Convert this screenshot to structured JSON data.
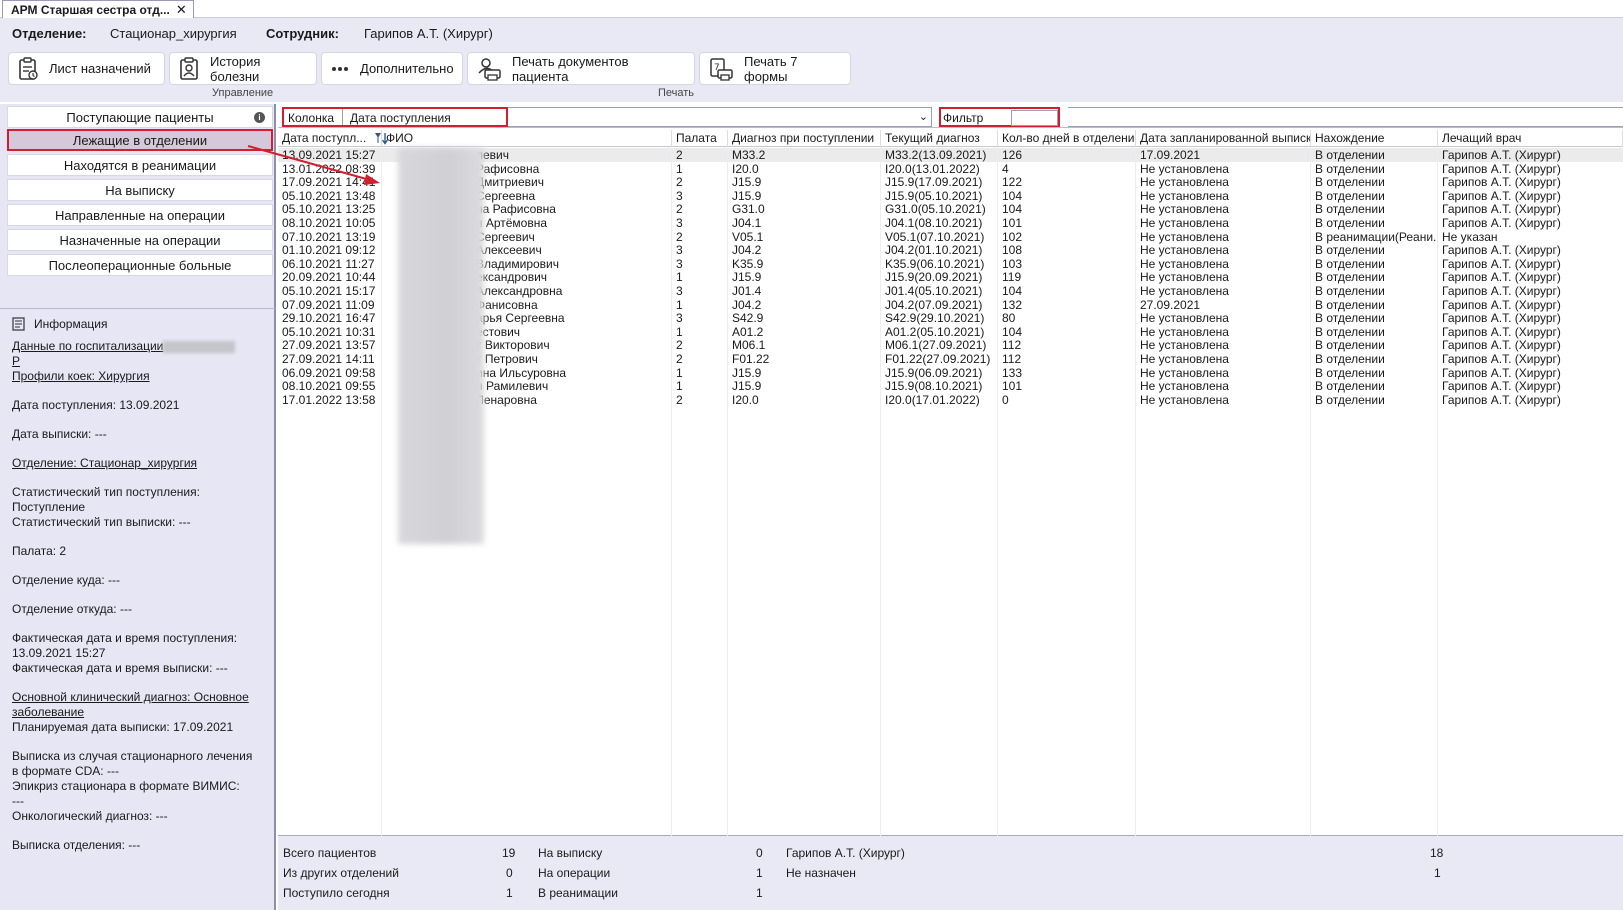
{
  "tab": {
    "title": "АРМ Старшая сестра отд...",
    "close": "✕"
  },
  "header": {
    "dept_label": "Отделение:",
    "dept_value": "Стационар_хирургия",
    "emp_label": "Сотрудник:",
    "emp_value": "Гарипов А.Т. (Хирург)"
  },
  "toolbar": {
    "list_label": "Лист назначений",
    "history_label": "История болезни",
    "more_label": "Дополнительно",
    "print_docs_label": "Печать документов пациента",
    "print7_label": "Печать 7 формы",
    "group_manage": "Управление",
    "group_print": "Печать"
  },
  "nav": {
    "items": [
      "Поступающие пациенты",
      "Лежащие в отделении",
      "Находятся в реанимации",
      "На выписку",
      "Направленные на операции",
      "Назначенные на операции",
      "Послеоперационные больные"
    ]
  },
  "info": {
    "title": "Информация",
    "hospitalization": "Данные по госпитализации",
    "p_letter": "Р",
    "bed_profile": "Профили коек: Хирургия",
    "admit_date": "Дата поступления: 13.09.2021",
    "discharge_date": "Дата выписки: ---",
    "department": "Отделение: Стационар_хирургия",
    "stat_admit_1": "Статистический тип поступления:",
    "stat_admit_2": "Поступление",
    "stat_discharge": "Статистический тип выписки: ---",
    "ward": "Палата: 2",
    "dept_to": "Отделение куда: ---",
    "dept_from": "Отделение откуда: ---",
    "actual_admit_1": "Фактическая дата и время поступления:",
    "actual_admit_2": "13.09.2021 15:27",
    "actual_discharge": "Фактическая дата и время выписки: ---",
    "diagnosis_1": "Основной клинический диагноз: Основное",
    "diagnosis_2": "заболевание",
    "planned_discharge": "Планируемая дата выписки: 17.09.2021",
    "cda_1": "Выписка из случая стационарного лечения",
    "cda_2": "в формате CDA: ---",
    "vimis_1": "Эпикриз стационара в формате ВИМИС:",
    "vimis_2": "---",
    "onco": "Онкологический диагноз: ---",
    "dept_discharge": "Выписка отделения: ---"
  },
  "filter": {
    "column_label": "Колонка",
    "column_value": "Дата поступления",
    "filter_label": "Фильтр",
    "filter_value": ""
  },
  "grid": {
    "headers": [
      "Дата поступл...",
      "ФИО",
      "Палата",
      "Диагноз при поступлении",
      "Текущий диагноз",
      "Кол-во дней в отделении",
      "Дата запланированной выписки",
      "Нахождение",
      "Лечащий врач"
    ],
    "rows": [
      [
        "13.09.2021 15:27",
        "левич",
        "2",
        "M33.2",
        "M33.2(13.09.2021)",
        "126",
        "17.09.2021",
        "В отделении",
        "Гарипов А.Т. (Хирург)"
      ],
      [
        "13.01.2022 08:39",
        "Рафисовна",
        "1",
        "I20.0",
        "I20.0(13.01.2022)",
        "4",
        "Не установлена",
        "В отделении",
        "Гарипов А.Т. (Хирург)"
      ],
      [
        "17.09.2021 14:41",
        "Дмитриевич",
        "2",
        "J15.9",
        "J15.9(17.09.2021)",
        "122",
        "Не установлена",
        "В отделении",
        "Гарипов А.Т. (Хирург)"
      ],
      [
        "05.10.2021 13:48",
        "Сергеевна",
        "3",
        "J15.9",
        "J15.9(05.10.2021)",
        "104",
        "Не установлена",
        "В отделении",
        "Гарипов А.Т. (Хирург)"
      ],
      [
        "05.10.2021 13:25",
        "на Рафисовна",
        "2",
        "G31.0",
        "G31.0(05.10.2021)",
        "104",
        "Не установлена",
        "В отделении",
        "Гарипов А.Т. (Хирург)"
      ],
      [
        "08.10.2021 10:05",
        "я Артёмовна",
        "3",
        "J04.1",
        "J04.1(08.10.2021)",
        "101",
        "Не установлена",
        "В отделении",
        "Гарипов А.Т. (Хирург)"
      ],
      [
        "07.10.2021 13:19",
        "Сергеевич",
        "2",
        "V05.1",
        "V05.1(07.10.2021)",
        "102",
        "Не установлена",
        "В реанимации(Реани...",
        "Не указан"
      ],
      [
        "01.10.2021 09:12",
        "Алексеевич",
        "3",
        "J04.2",
        "J04.2(01.10.2021)",
        "108",
        "Не установлена",
        "В отделении",
        "Гарипов А.Т. (Хирург)"
      ],
      [
        "06.10.2021 11:27",
        "Владимирович",
        "3",
        "K35.9",
        "K35.9(06.10.2021)",
        "103",
        "Не установлена",
        "В отделении",
        "Гарипов А.Т. (Хирург)"
      ],
      [
        "20.09.2021 10:44",
        "ександрович",
        "1",
        "J15.9",
        "J15.9(20.09.2021)",
        "119",
        "Не установлена",
        "В отделении",
        "Гарипов А.Т. (Хирург)"
      ],
      [
        "05.10.2021 15:17",
        "Александровна",
        "3",
        "J01.4",
        "J01.4(05.10.2021)",
        "104",
        "Не установлена",
        "В отделении",
        "Гарипов А.Т. (Хирург)"
      ],
      [
        "07.09.2021 11:09",
        "Фанисовна",
        "1",
        "J04.2",
        "J04.2(07.09.2021)",
        "132",
        "27.09.2021",
        "В отделении",
        "Гарипов А.Т. (Хирург)"
      ],
      [
        "29.10.2021 16:47",
        "арья Сергеевна",
        "3",
        "S42.9",
        "S42.9(29.10.2021)",
        "80",
        "Не установлена",
        "В отделении",
        "Гарипов А.Т. (Хирург)"
      ],
      [
        "05.10.2021 10:31",
        "естович",
        "1",
        "A01.2",
        "A01.2(05.10.2021)",
        "104",
        "Не установлена",
        "В отделении",
        "Гарипов А.Т. (Хирург)"
      ],
      [
        "27.09.2021 13:57",
        "т Викторович",
        "2",
        "M06.1",
        "M06.1(27.09.2021)",
        "112",
        "Не установлена",
        "В отделении",
        "Гарипов А.Т. (Хирург)"
      ],
      [
        "27.09.2021 14:11",
        "т Петрович",
        "2",
        "F01.22",
        "F01.22(27.09.2021)",
        "112",
        "Не установлена",
        "В отделении",
        "Гарипов А.Т. (Хирург)"
      ],
      [
        "06.09.2021 09:58",
        "ина Ильсуровна",
        "1",
        "J15.9",
        "J15.9(06.09.2021)",
        "133",
        "Не установлена",
        "В отделении",
        "Гарипов А.Т. (Хирург)"
      ],
      [
        "08.10.2021 09:55",
        "н Рамилевич",
        "1",
        "J15.9",
        "J15.9(08.10.2021)",
        "101",
        "Не установлена",
        "В отделении",
        "Гарипов А.Т. (Хирург)"
      ],
      [
        "17.01.2022 13:58",
        "Ленаровна",
        "2",
        "I20.0",
        "I20.0(17.01.2022)",
        "0",
        "Не установлена",
        "В отделении",
        "Гарипов А.Т. (Хирург)"
      ]
    ]
  },
  "status": {
    "total_label": "Всего пациентов",
    "total_value": "19",
    "other_label": "Из других отделений",
    "other_value": "0",
    "today_label": "Поступило сегодня",
    "today_value": "1",
    "discharge_label": "На выписку",
    "discharge_value": "0",
    "ops_label": "На операции",
    "ops_value": "1",
    "icu_label": "В реанимации",
    "icu_value": "1",
    "doctor_label": "Гарипов А.Т. (Хирург)",
    "doctor_value": "18",
    "unassigned_label": "Не назначен",
    "unassigned_value": "1"
  },
  "colors": {
    "accent_red": "#d21e2e",
    "panel_bg": "#e6e6f4",
    "selected_nav": "#d5c8da"
  }
}
